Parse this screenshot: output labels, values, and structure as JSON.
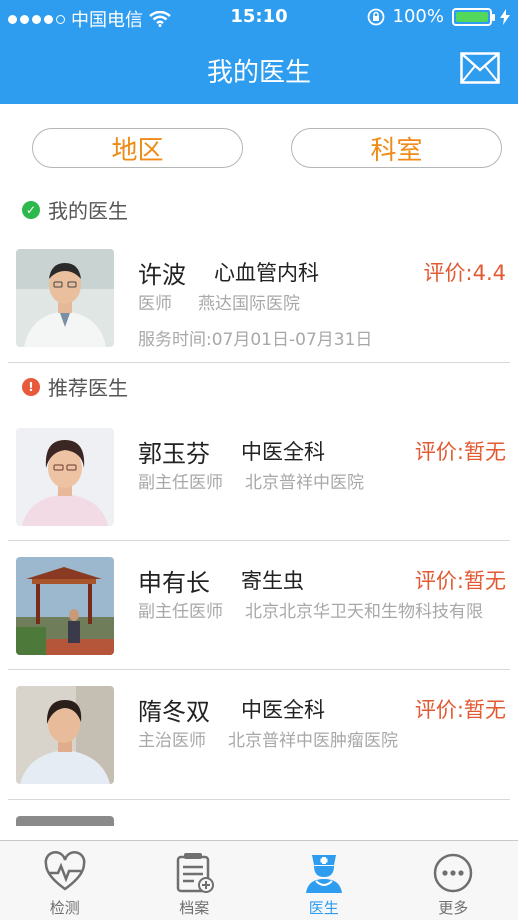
{
  "status_bar": {
    "carrier": "中国电信",
    "time": "15:10",
    "battery": "100%"
  },
  "nav": {
    "title": "我的医生"
  },
  "filters": {
    "region": "地区",
    "department": "科室"
  },
  "my_doctors": {
    "heading": "我的医生",
    "items": [
      {
        "name": "许波",
        "department": "心血管内科",
        "rating": "评价:4.4",
        "title": "医师",
        "hospital": "燕达国际医院",
        "service": "服务时间:07月01日-07月31日"
      }
    ]
  },
  "recommended": {
    "heading": "推荐医生",
    "items": [
      {
        "name": "郭玉芬",
        "department": "中医全科",
        "rating": "评价:暂无",
        "title": "副主任医师",
        "hospital": "北京普祥中医院"
      },
      {
        "name": "申有长",
        "department": "寄生虫",
        "rating": "评价:暂无",
        "title": "副主任医师",
        "hospital": "北京北京华卫天和生物科技有限"
      },
      {
        "name": "隋冬双",
        "department": "中医全科",
        "rating": "评价:暂无",
        "title": "主治医师",
        "hospital": "北京普祥中医肿瘤医院"
      }
    ]
  },
  "tabs": [
    {
      "label": "检测",
      "icon": "heart-pulse-icon"
    },
    {
      "label": "档案",
      "icon": "clipboard-icon"
    },
    {
      "label": "医生",
      "icon": "nurse-icon"
    },
    {
      "label": "更多",
      "icon": "more-icon"
    }
  ],
  "colors": {
    "primary": "#2e9df0",
    "accent": "#f08a18",
    "rating": "#e25a32"
  }
}
